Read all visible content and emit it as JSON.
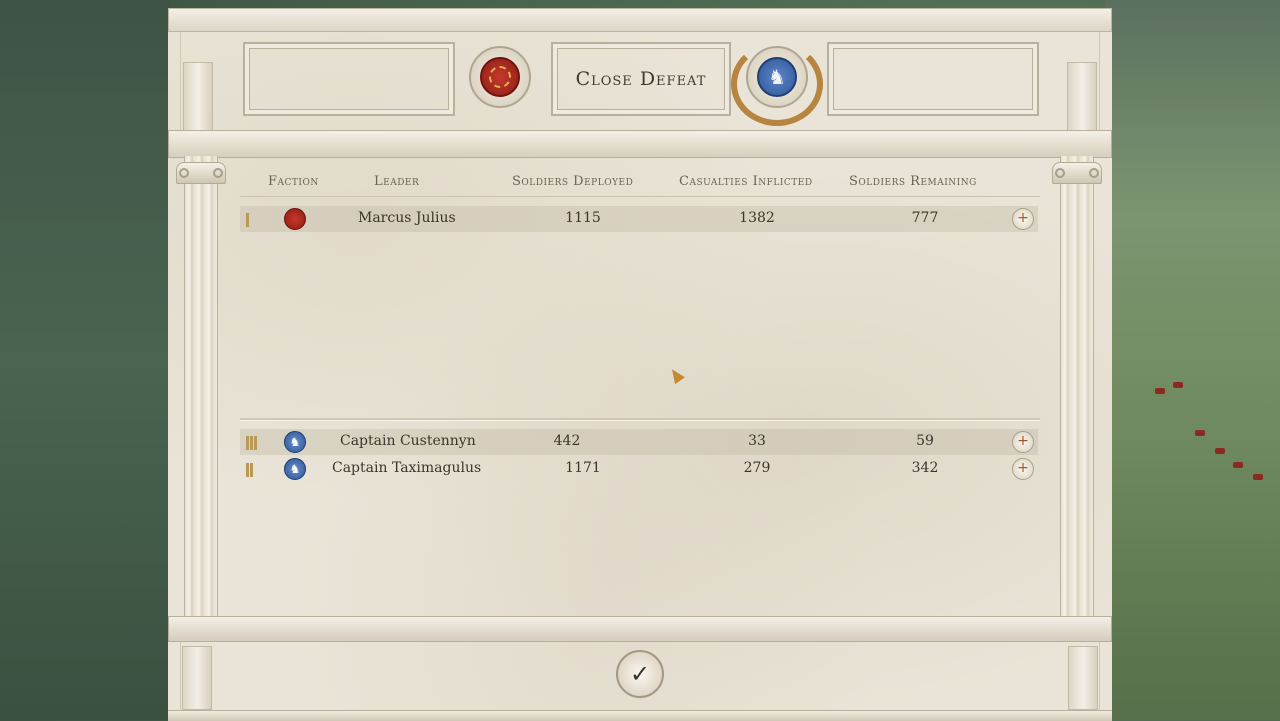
{
  "result_title": "Close Defeat",
  "player_faction_icon": "rome-eagle-emblem",
  "enemy_faction_icon": "white-stag-emblem",
  "columns": {
    "faction": "Faction",
    "leader": "Leader",
    "deployed": "Soldiers Deployed",
    "casualties": "Casualties Inflicted",
    "remaining": "Soldiers Remaining"
  },
  "player_rows": [
    {
      "leader": "Marcus Julius",
      "deployed": "1115",
      "casualties": "1382",
      "remaining": "777"
    }
  ],
  "enemy_rows": [
    {
      "leader": "Captain Custennyn",
      "deployed": "442",
      "casualties": "33",
      "remaining": "59"
    },
    {
      "leader": "Captain Taximagulus",
      "deployed": "1171",
      "casualties": "279",
      "remaining": "342"
    }
  ],
  "colors": {
    "player": "#a8271c",
    "enemy": "#3a66ad",
    "accent": "#b7853f"
  },
  "confirm_icon": "checkmark-icon",
  "confirm_glyph": "✓",
  "info_glyph": "+"
}
